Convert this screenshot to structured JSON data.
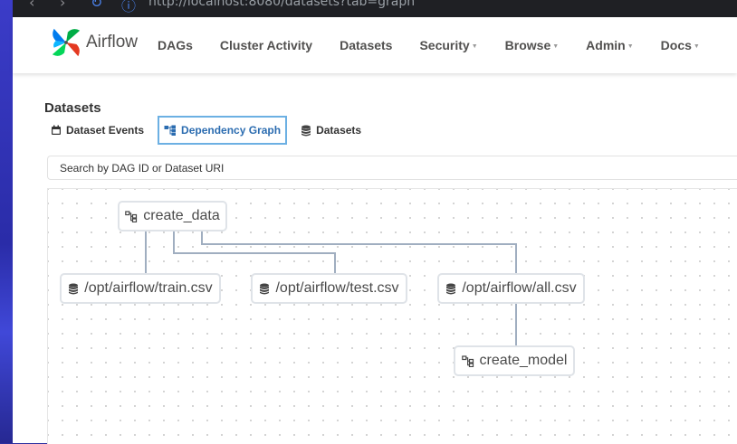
{
  "browser": {
    "url": "http://localhost:8080/datasets?tab=graph"
  },
  "brand": {
    "name": "Airflow"
  },
  "nav": [
    {
      "label": "DAGs",
      "dropdown": false
    },
    {
      "label": "Cluster Activity",
      "dropdown": false
    },
    {
      "label": "Datasets",
      "dropdown": false
    },
    {
      "label": "Security",
      "dropdown": true
    },
    {
      "label": "Browse",
      "dropdown": true
    },
    {
      "label": "Admin",
      "dropdown": true
    },
    {
      "label": "Docs",
      "dropdown": true
    }
  ],
  "page": {
    "heading": "Datasets"
  },
  "tabs": [
    {
      "label": "Dataset Events",
      "icon": "calendar-icon",
      "active": false
    },
    {
      "label": "Dependency Graph",
      "icon": "graph-icon",
      "active": true
    },
    {
      "label": "Datasets",
      "icon": "database-icon",
      "active": false
    }
  ],
  "search": {
    "placeholder": "Search by DAG ID or Dataset URI"
  },
  "graph": {
    "nodes": {
      "create_data": {
        "label": "create_data",
        "kind": "dag",
        "icon": "dag-icon"
      },
      "train": {
        "label": "/opt/airflow/train.csv",
        "kind": "dataset",
        "icon": "database-icon"
      },
      "test": {
        "label": "/opt/airflow/test.csv",
        "kind": "dataset",
        "icon": "database-icon"
      },
      "all": {
        "label": "/opt/airflow/all.csv",
        "kind": "dataset",
        "icon": "database-icon"
      },
      "create_model": {
        "label": "create_model",
        "kind": "dag",
        "icon": "dag-icon"
      }
    },
    "edges": [
      {
        "from": "create_data",
        "to": "train"
      },
      {
        "from": "create_data",
        "to": "test"
      },
      {
        "from": "create_data",
        "to": "all"
      },
      {
        "from": "all",
        "to": "create_model"
      }
    ],
    "edge_color": "#a0aec0"
  },
  "colors": {
    "active_tab_border": "#6cb0e3",
    "active_tab_text": "#2b6cb0",
    "nav_text": "#51504f"
  }
}
